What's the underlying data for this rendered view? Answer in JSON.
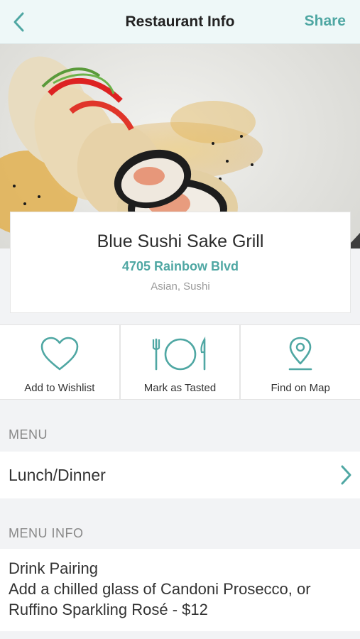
{
  "nav": {
    "title": "Restaurant Info",
    "share_label": "Share",
    "back_icon": "chevron-left-icon"
  },
  "restaurant": {
    "name": "Blue Sushi Sake Grill",
    "address": "4705 Rainbow Blvd",
    "cuisine": "Asian, Sushi"
  },
  "actions": [
    {
      "label": "Add to Wishlist",
      "icon": "heart-icon"
    },
    {
      "label": "Mark as Tasted",
      "icon": "utensils-plate-icon"
    },
    {
      "label": "Find on Map",
      "icon": "map-pin-icon"
    }
  ],
  "menu": {
    "header": "MENU",
    "items": [
      {
        "label": "Lunch/Dinner"
      }
    ]
  },
  "menu_info": {
    "header": "MENU INFO",
    "title": "Drink Pairing",
    "description": "Add a chilled glass of Candoni Prosecco, or Ruffino Sparkling Rosé - $12"
  },
  "colors": {
    "accent": "#4fa7a3",
    "nav_bg": "#eef8f8",
    "page_bg": "#f2f3f5"
  }
}
